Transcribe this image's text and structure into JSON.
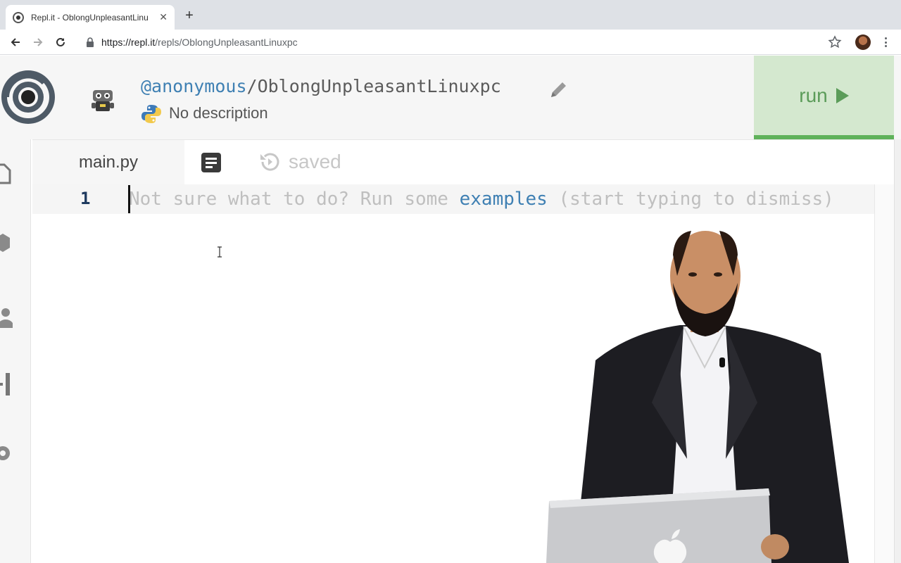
{
  "browser": {
    "tab_title": "Repl.it - OblongUnpleasantLinu",
    "url_host": "https://repl.it",
    "url_path": "/repls/OblongUnpleasantLinuxpc"
  },
  "repl": {
    "owner": "@anonymous",
    "separator": "/",
    "name": "OblongUnpleasantLinuxpc",
    "description": "No description",
    "run_label": "run",
    "file_tab": "main.py",
    "save_status": "saved",
    "line_number": "1",
    "placeholder_before": "Not sure what to do? Run some ",
    "placeholder_link": "examples",
    "placeholder_after": " (start typing to dismiss)"
  },
  "colors": {
    "accent": "#3f80b3",
    "run_bg": "#d4e8cf",
    "run_fg": "#5b9c59",
    "run_bar": "#5fb25a"
  },
  "icons": [
    "replit-logo-icon",
    "bot-avatar-icon",
    "pencil-icon",
    "python-icon",
    "document-icon",
    "history-icon",
    "play-icon",
    "files-icon",
    "packages-icon",
    "multiplayer-icon",
    "debugger-icon",
    "settings-icon"
  ]
}
